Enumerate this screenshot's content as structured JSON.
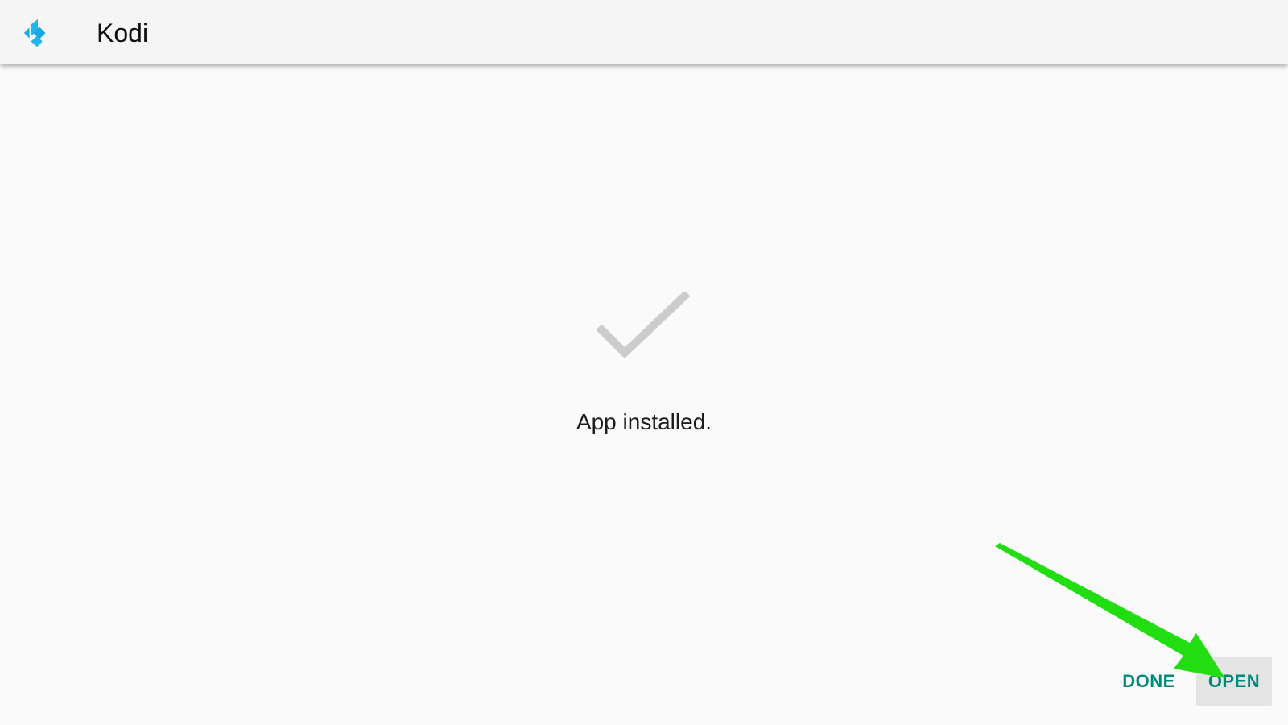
{
  "app_bar": {
    "title": "Kodi",
    "icon": "kodi-logo-icon"
  },
  "main": {
    "status_icon": "checkmark-icon",
    "status_text": "App installed."
  },
  "actions": {
    "done_label": "DONE",
    "open_label": "OPEN"
  },
  "annotation": {
    "icon": "arrow-pointer-icon",
    "color": "#22dd11"
  },
  "colors": {
    "accent": "#00897b",
    "app_bar_bg": "#f5f5f5",
    "background": "#fafafa",
    "checkmark": "#cccccc",
    "kodi_blue": "#17a9e1",
    "open_button_bg": "#e4e4e4"
  }
}
